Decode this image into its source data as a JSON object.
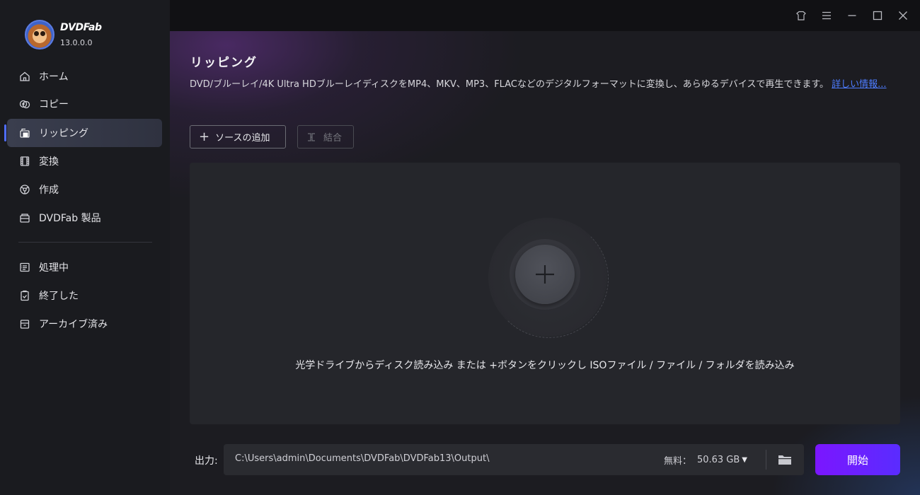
{
  "app": {
    "brand_name": "DVDFab",
    "version": "13.0.0.0"
  },
  "sidebar": {
    "items": [
      {
        "label": "ホーム",
        "icon": "home-icon"
      },
      {
        "label": "コピー",
        "icon": "copy-icon"
      },
      {
        "label": "リッピング",
        "icon": "ripper-icon",
        "active": true
      },
      {
        "label": "変換",
        "icon": "film-icon"
      },
      {
        "label": "作成",
        "icon": "creator-icon"
      },
      {
        "label": "DVDFab 製品",
        "icon": "products-icon"
      }
    ],
    "tasks": [
      {
        "label": "処理中",
        "icon": "processing-icon"
      },
      {
        "label": "終了した",
        "icon": "finished-icon"
      },
      {
        "label": "アーカイブ済み",
        "icon": "archive-icon"
      }
    ]
  },
  "titlebar": {
    "icons": [
      "skin-icon",
      "menu-icon",
      "minimize-icon",
      "maximize-icon",
      "close-icon"
    ]
  },
  "main": {
    "title": "リッピング",
    "description": "DVD/ブルーレイ/4K Ultra HDブルーレイディスクをMP4、MKV、MP3、FLACなどのデジタルフォーマットに変換し、あらゆるデバイスで再生できます。",
    "more_link": "詳しい情報...",
    "add_source_label": "ソースの追加",
    "merge_label": "結合",
    "drop_hint": "光学ドライブからディスク読み込み または +ボタンをクリックし ISOファイル / ファイル / フォルダを読み込み"
  },
  "output": {
    "label": "出力:",
    "path": "C:\\Users\\admin\\Documents\\DVDFab\\DVDFab13\\Output\\",
    "free_label": "無料：",
    "free_value": "50.63 GB",
    "start_label": "開始"
  },
  "colors": {
    "accent": "#4f6dff",
    "start_button": "#7b16ff",
    "link": "#4d7cff"
  }
}
